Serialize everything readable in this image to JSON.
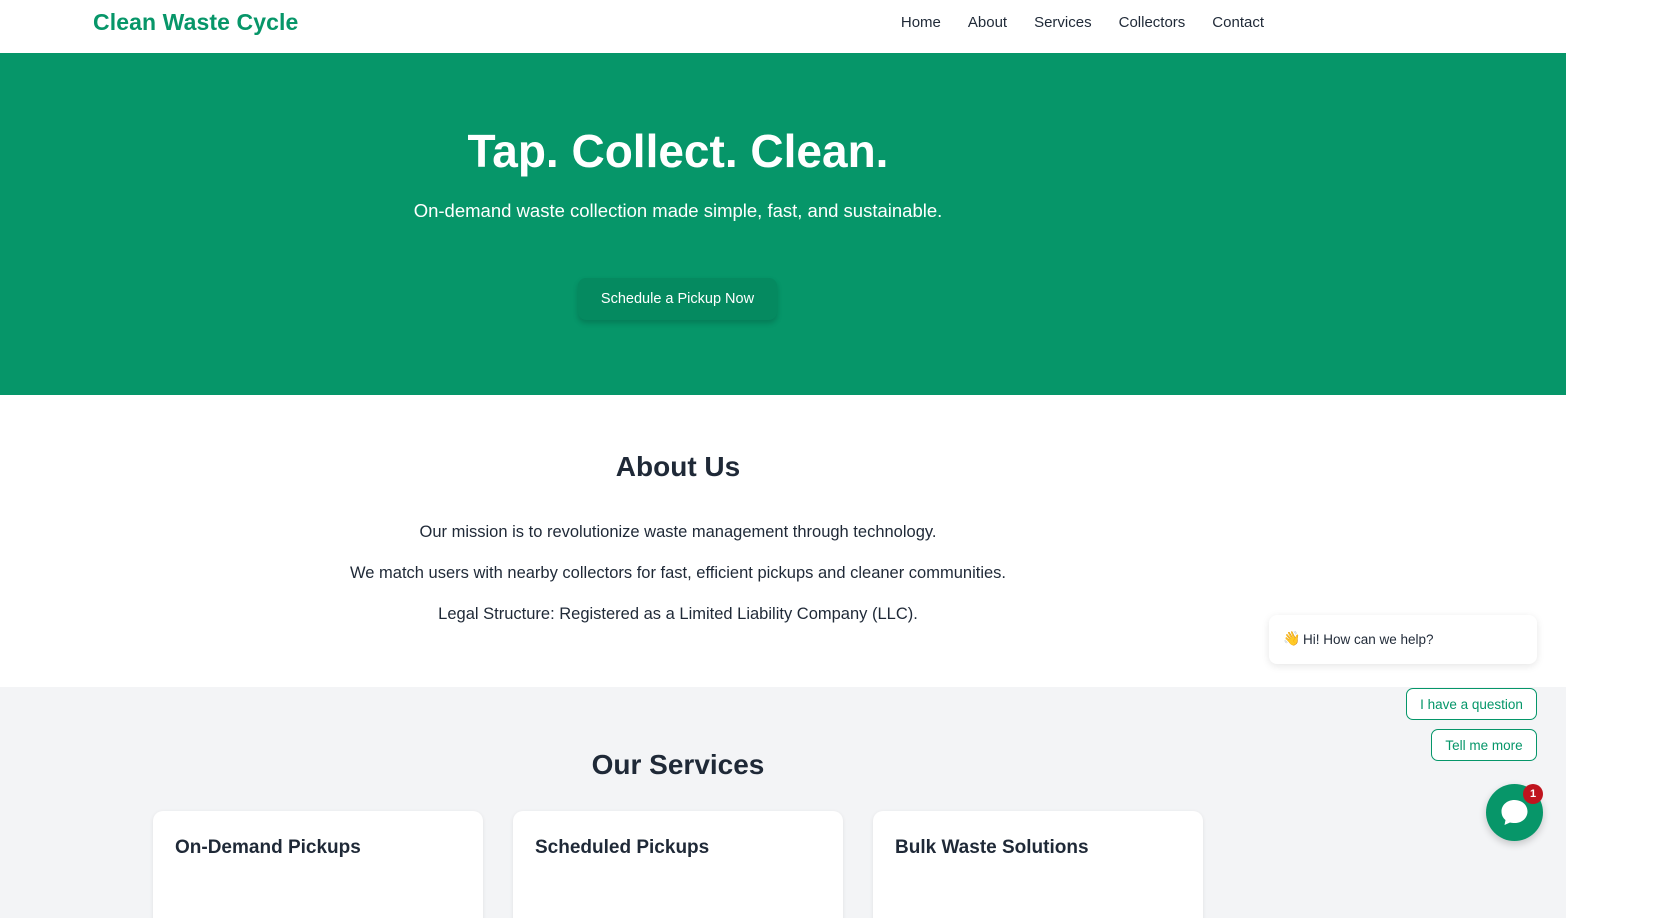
{
  "header": {
    "logo": "Clean Waste Cycle",
    "nav": [
      "Home",
      "About",
      "Services",
      "Collectors",
      "Contact"
    ]
  },
  "hero": {
    "title": "Tap. Collect. Clean.",
    "subtitle": "On-demand waste collection made simple, fast, and sustainable.",
    "cta": "Schedule a Pickup Now"
  },
  "about": {
    "title": "About Us",
    "paragraphs": [
      "Our mission is to revolutionize waste management through technology.",
      "We match users with nearby collectors for fast, efficient pickups and cleaner communities.",
      "Legal Structure: Registered as a Limited Liability Company (LLC)."
    ]
  },
  "services": {
    "title": "Our Services",
    "cards": [
      {
        "title": "On-Demand Pickups"
      },
      {
        "title": "Scheduled Pickups"
      },
      {
        "title": "Bulk Waste Solutions"
      }
    ]
  },
  "chat": {
    "greeting_icon": "waving-hand-icon",
    "greeting": "Hi! How can we help?",
    "options": [
      "I have a question",
      "Tell me more"
    ],
    "badge_count": "1",
    "launcher_icon": "chat-bubble-icon"
  },
  "colors": {
    "brand": "#069669",
    "accent_text": "#059669",
    "badge": "#c0141e",
    "section_bg": "#f3f4f6"
  }
}
